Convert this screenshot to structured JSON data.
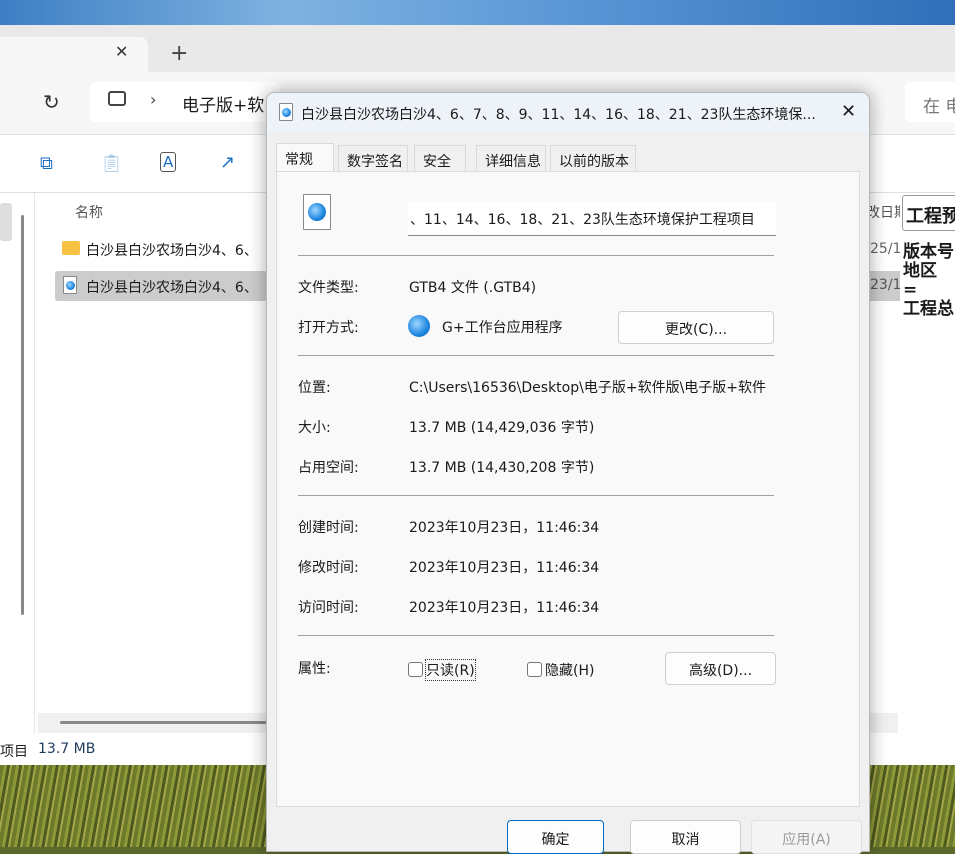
{
  "explorer": {
    "tab_close": "✕",
    "new_tab": "+",
    "breadcrumb": [
      "电子版+软"
    ],
    "search_placeholder": "在 电",
    "column_name": "名称",
    "column_date": "改日期",
    "files": [
      {
        "name": "白沙县白沙农场白沙4、6、",
        "type": "folder",
        "date": "25/1"
      },
      {
        "name": "白沙县白沙农场白沙4、6、",
        "type": "gtb4",
        "date": "23/1",
        "selected": true
      }
    ],
    "status": {
      "items_suffix": "项目",
      "size": "13.7 MB"
    },
    "preview": {
      "title": "工程预",
      "lines": [
        "版本号",
        "地区 =",
        "工程总"
      ]
    }
  },
  "dialog": {
    "title": "白沙县白沙农场白沙4、6、7、8、9、11、14、16、18、21、23队生态环境保...",
    "tabs": [
      "常规",
      "数字签名",
      "安全",
      "详细信息",
      "以前的版本"
    ],
    "active_tab": "常规",
    "filename": "、11、14、16、18、21、23队生态环境保护工程项目",
    "rows": [
      {
        "label": "文件类型:",
        "value": "GTB4 文件 (.GTB4)"
      },
      {
        "label": "打开方式:",
        "value": "G+工作台应用程序",
        "button": "更改(C)..."
      },
      {
        "label": "位置:",
        "value": "C:\\Users\\16536\\Desktop\\电子版+软件版\\电子版+软件"
      },
      {
        "label": "大小:",
        "value": "13.7 MB (14,429,036 字节)"
      },
      {
        "label": "占用空间:",
        "value": "13.7 MB (14,430,208 字节)"
      },
      {
        "label": "创建时间:",
        "value": "2023年10月23日，11:46:34"
      },
      {
        "label": "修改时间:",
        "value": "2023年10月23日，11:46:34"
      },
      {
        "label": "访问时间:",
        "value": "2023年10月23日，11:46:34"
      }
    ],
    "attributes": {
      "label": "属性:",
      "readonly": "只读(R)",
      "readonly_checked": false,
      "hidden": "隐藏(H)",
      "hidden_checked": false,
      "advanced": "高级(D)..."
    },
    "buttons": {
      "ok": "确定",
      "cancel": "取消",
      "apply": "应用(A)"
    },
    "accent": "#0067c0"
  }
}
